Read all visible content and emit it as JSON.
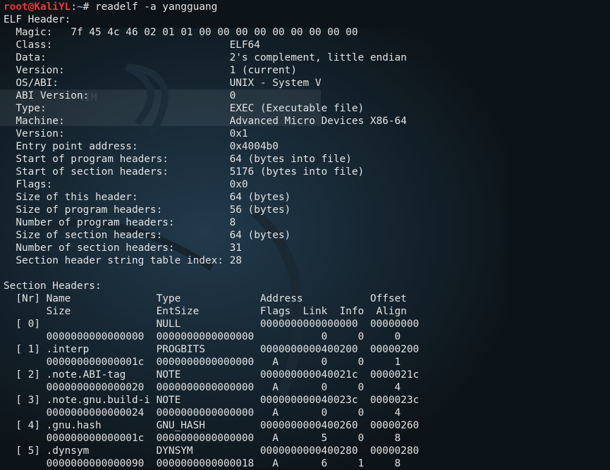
{
  "prompt": {
    "user_host": "root@KaliYL",
    "colon": ":",
    "path": "~",
    "symbol": "# ",
    "command": "readelf -a yangguang"
  },
  "wallpaper": {
    "label": "VIM"
  },
  "output": [
    "ELF Header:",
    "  Magic:   7f 45 4c 46 02 01 01 00 00 00 00 00 00 00 00 00",
    "  Class:                             ELF64",
    "  Data:                              2's complement, little endian",
    "  Version:                           1 (current)",
    "  OS/ABI:                            UNIX - System V",
    "  ABI Version:                       0",
    "  Type:                              EXEC (Executable file)",
    "  Machine:                           Advanced Micro Devices X86-64",
    "  Version:                           0x1",
    "  Entry point address:               0x4004b0",
    "  Start of program headers:          64 (bytes into file)",
    "  Start of section headers:          5176 (bytes into file)",
    "  Flags:                             0x0",
    "  Size of this header:               64 (bytes)",
    "  Size of program headers:           56 (bytes)",
    "  Number of program headers:         8",
    "  Size of section headers:           64 (bytes)",
    "  Number of section headers:         31",
    "  Section header string table index: 28",
    "",
    "Section Headers:",
    "  [Nr] Name              Type             Address           Offset",
    "       Size              EntSize          Flags  Link  Info  Align",
    "  [ 0]                   NULL             0000000000000000  00000000",
    "       0000000000000000  0000000000000000           0     0     0",
    "  [ 1] .interp           PROGBITS         0000000000400200  00000200",
    "       000000000000001c  0000000000000000   A       0     0     1",
    "  [ 2] .note.ABI-tag     NOTE             000000000040021c  0000021c",
    "       0000000000000020  0000000000000000   A       0     0     4",
    "  [ 3] .note.gnu.build-i NOTE             000000000040023c  0000023c",
    "       0000000000000024  0000000000000000   A       0     0     4",
    "  [ 4] .gnu.hash         GNU_HASH         0000000000400260  00000260",
    "       000000000000001c  0000000000000000   A       5     0     8",
    "  [ 5] .dynsym           DYNSYM           0000000000400280  00000280",
    "       0000000000000090  0000000000000018   A       6     1     8"
  ]
}
